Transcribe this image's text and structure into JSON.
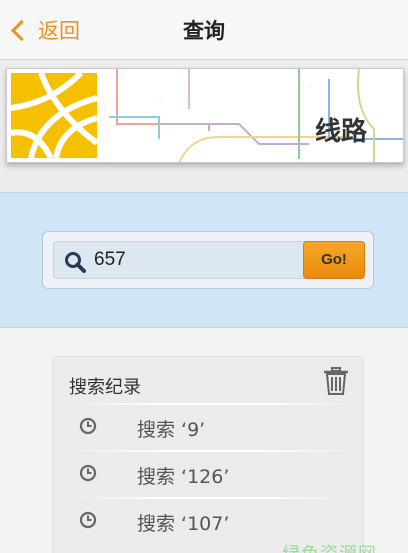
{
  "nav": {
    "back_label": "返回",
    "title": "查询"
  },
  "banner": {
    "label": "线路"
  },
  "search": {
    "value": "657",
    "go_label": "Go!"
  },
  "history": {
    "title": "搜索纪录",
    "items": [
      {
        "label": "搜索 ‘9’"
      },
      {
        "label": "搜索 ‘126’"
      },
      {
        "label": "搜索 ‘107’"
      }
    ]
  },
  "watermark": "绿色资源网",
  "colors": {
    "accent": "#f0901e",
    "globe_yellow": "#f5c000",
    "search_band": "#cfe6f6"
  }
}
